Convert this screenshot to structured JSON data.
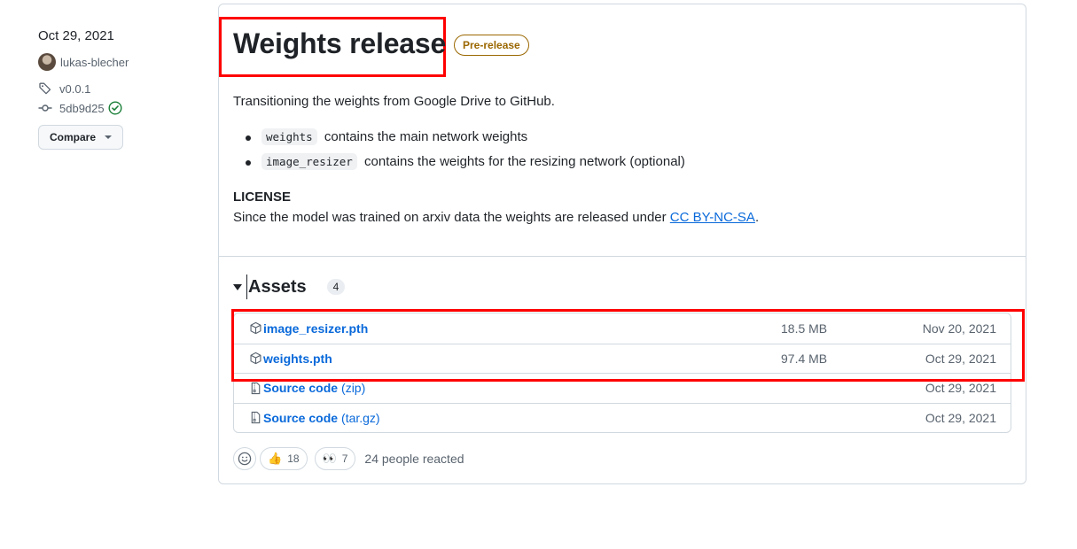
{
  "meta": {
    "date": "Oct 29, 2021",
    "author": "lukas-blecher",
    "tag": "v0.0.1",
    "commit": "5db9d25",
    "compare_label": "Compare"
  },
  "release": {
    "title": "Weights release",
    "badge": "Pre-release",
    "intro": "Transitioning the weights from Google Drive to GitHub.",
    "bullets": [
      {
        "code": "weights",
        "text": "contains the main network weights"
      },
      {
        "code": "image_resizer",
        "text": "contains the weights for the resizing network (optional)"
      }
    ],
    "license_heading": "LICENSE",
    "license_text": "Since the model was trained on arxiv data the weights are released under",
    "license_link": "CC BY-NC-SA",
    "license_end": "."
  },
  "assets": {
    "title": "Assets",
    "count": "4",
    "items": [
      {
        "name": "image_resizer.pth",
        "ext": "",
        "size": "18.5 MB",
        "date": "Nov 20, 2021"
      },
      {
        "name": "weights.pth",
        "ext": "",
        "size": "97.4 MB",
        "date": "Oct 29, 2021"
      },
      {
        "name": "Source code",
        "ext": "(zip)",
        "size": "",
        "date": "Oct 29, 2021"
      },
      {
        "name": "Source code",
        "ext": "(tar.gz)",
        "size": "",
        "date": "Oct 29, 2021"
      }
    ]
  },
  "reactions": {
    "thumbs_emoji": "👍",
    "thumbs_count": "18",
    "eyes_emoji": "👀",
    "eyes_count": "7",
    "summary": "24 people reacted"
  },
  "colors": {
    "link": "#0969da",
    "prerelease": "#9a6700",
    "highlight": "#ff0000",
    "verified": "#1a7f37"
  }
}
